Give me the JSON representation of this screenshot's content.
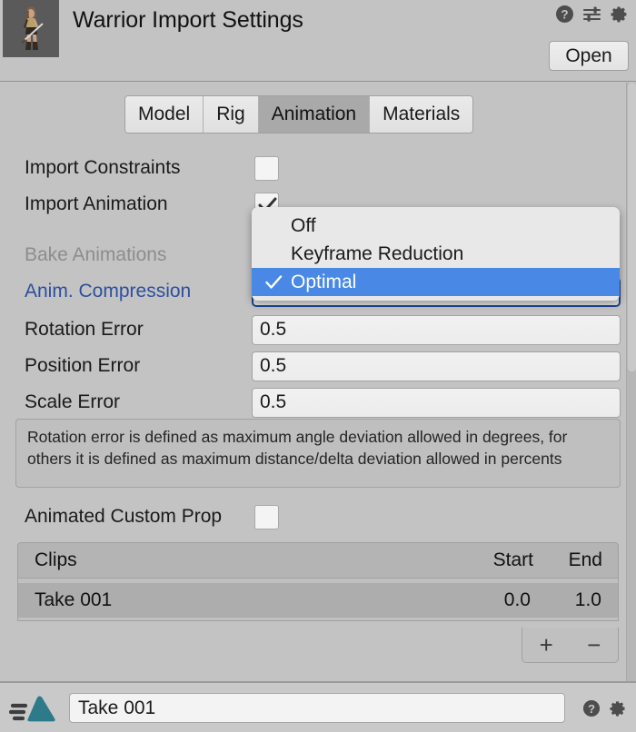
{
  "header": {
    "title": "Warrior Import Settings",
    "thumbnail_name": "warrior-character-preview",
    "open_label": "Open",
    "icons": [
      {
        "name": "help-icon",
        "glyph": "?"
      },
      {
        "name": "preset-icon",
        "glyph": "sliders"
      },
      {
        "name": "gear-icon",
        "glyph": "gear"
      }
    ]
  },
  "tabs": [
    {
      "label": "Model",
      "active": false
    },
    {
      "label": "Rig",
      "active": false
    },
    {
      "label": "Animation",
      "active": true
    },
    {
      "label": "Materials",
      "active": false
    }
  ],
  "rows": {
    "import_constraints": {
      "label": "Import Constraints",
      "checked": false
    },
    "import_animation": {
      "label": "Import Animation",
      "checked": true
    },
    "bake_animations": {
      "label": "Bake Animations",
      "state": "disabled"
    },
    "anim_compression": {
      "label": "Anim. Compression",
      "value": "Optimal",
      "state": "modified"
    },
    "rotation_error": {
      "label": "Rotation Error",
      "value": "0.5"
    },
    "position_error": {
      "label": "Position Error",
      "value": "0.5"
    },
    "scale_error": {
      "label": "Scale Error",
      "value": "0.5"
    },
    "animated_custom_properties": {
      "label": "Animated Custom Prop",
      "checked": false
    }
  },
  "dropdown": {
    "open": true,
    "options": [
      {
        "label": "Off",
        "selected": false
      },
      {
        "label": "Keyframe Reduction",
        "selected": false
      },
      {
        "label": "Optimal",
        "selected": true
      }
    ],
    "highlight_color": "#4a88e5"
  },
  "info_box": {
    "text": "Rotation error is defined as maximum angle deviation allowed in degrees, for others it is defined as maximum distance/delta deviation allowed in percents"
  },
  "clips_table": {
    "columns": {
      "name": "Clips",
      "start": "Start",
      "end": "End"
    },
    "rows": [
      {
        "name": "Take 001",
        "start": "0.0",
        "end": "1.0",
        "selected": true
      }
    ],
    "add_label": "+",
    "remove_label": "−"
  },
  "bottom_bar": {
    "clip_icon_name": "animation-clip-icon",
    "clip_icon_color": "#2d7a8a",
    "name_value": "Take 001",
    "icons": [
      {
        "name": "help-icon",
        "glyph": "?"
      },
      {
        "name": "gear-icon",
        "glyph": "gear"
      }
    ]
  },
  "colors": {
    "background": "#c3c3c3",
    "selection_blue": "#4a88e5",
    "modified_text": "#2d4f9e",
    "disabled_text": "#8d8d8d",
    "tab_active": "#a9a9a9"
  }
}
